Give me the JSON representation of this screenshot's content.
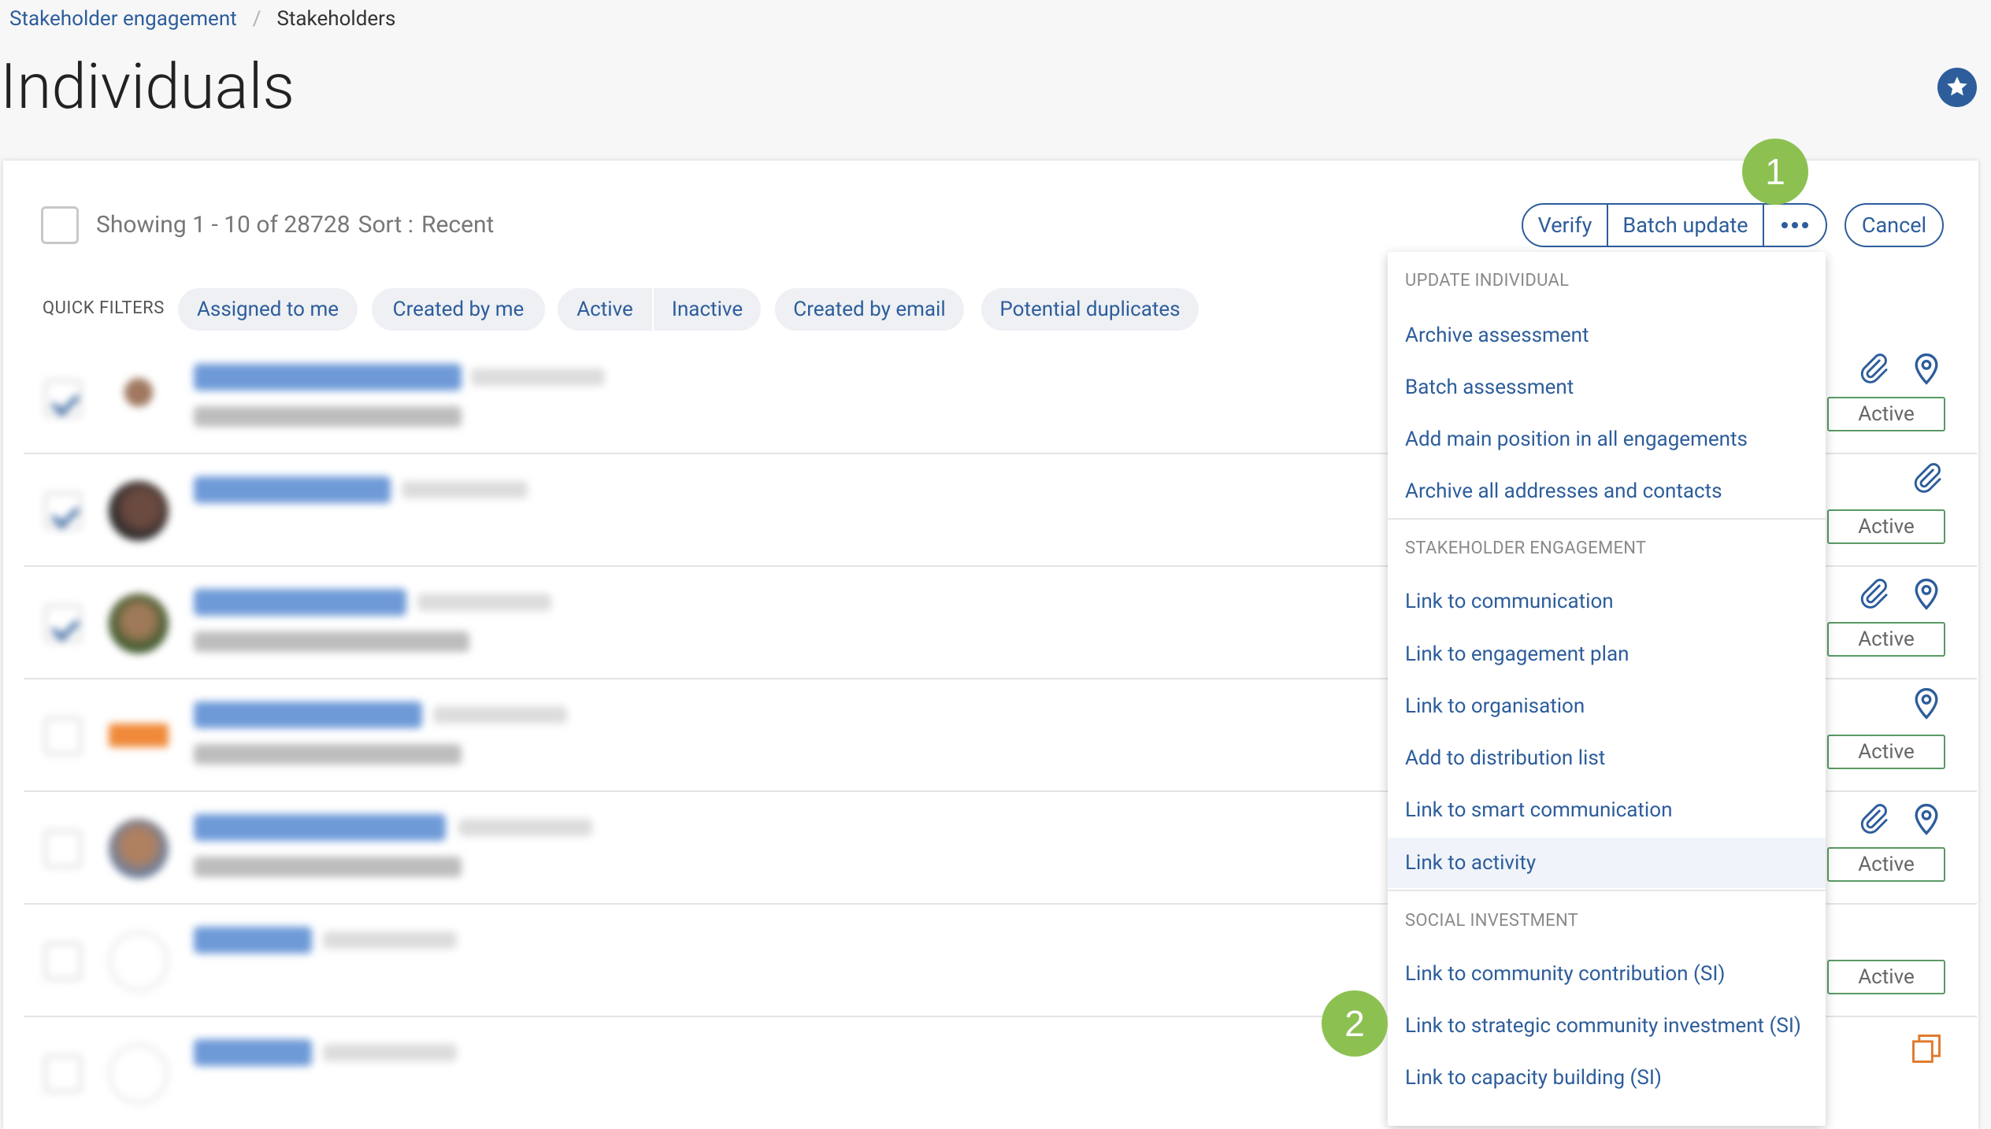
{
  "breadcrumb": {
    "parent": "Stakeholder engagement",
    "separator": "/",
    "current": "Stakeholders"
  },
  "page": {
    "title": "Individuals"
  },
  "toolbar": {
    "showing": "Showing 1 - 10 of 28728",
    "sort_label": "Sort :",
    "sort_value": "Recent",
    "verify_label": "Verify",
    "batch_update_label": "Batch update",
    "cancel_label": "Cancel"
  },
  "quick_filters": {
    "label": "QUICK FILTERS",
    "assigned_to_me": "Assigned to me",
    "created_by_me": "Created by me",
    "active": "Active",
    "inactive": "Inactive",
    "created_by_email": "Created by email",
    "potential_duplicates": "Potential duplicates"
  },
  "rows": [
    {
      "checked": true,
      "status": "Active"
    },
    {
      "checked": true,
      "status": "Active"
    },
    {
      "checked": true,
      "status": "Active"
    },
    {
      "checked": false,
      "status": "Active"
    },
    {
      "checked": false,
      "status": "Active"
    },
    {
      "checked": false,
      "status": "Active"
    },
    {
      "checked": false,
      "status": ""
    }
  ],
  "menu": {
    "sections": [
      {
        "title": "UPDATE INDIVIDUAL",
        "items": [
          "Archive assessment",
          "Batch assessment",
          "Add main position in all engagements",
          "Archive all addresses and contacts"
        ]
      },
      {
        "title": "STAKEHOLDER ENGAGEMENT",
        "items": [
          "Link to communication",
          "Link to engagement plan",
          "Link to organisation",
          "Add to distribution list",
          "Link to smart communication",
          "Link to activity"
        ]
      },
      {
        "title": "SOCIAL INVESTMENT",
        "items": [
          "Link to community contribution (SI)",
          "Link to strategic community investment (SI)",
          "Link to capacity building (SI)"
        ]
      }
    ],
    "highlighted": "Link to activity"
  },
  "markers": {
    "step1": "1",
    "step2": "2"
  },
  "colors": {
    "accent": "#2d5d9b",
    "marker": "#8cc152",
    "status_border": "#5a9a64"
  }
}
